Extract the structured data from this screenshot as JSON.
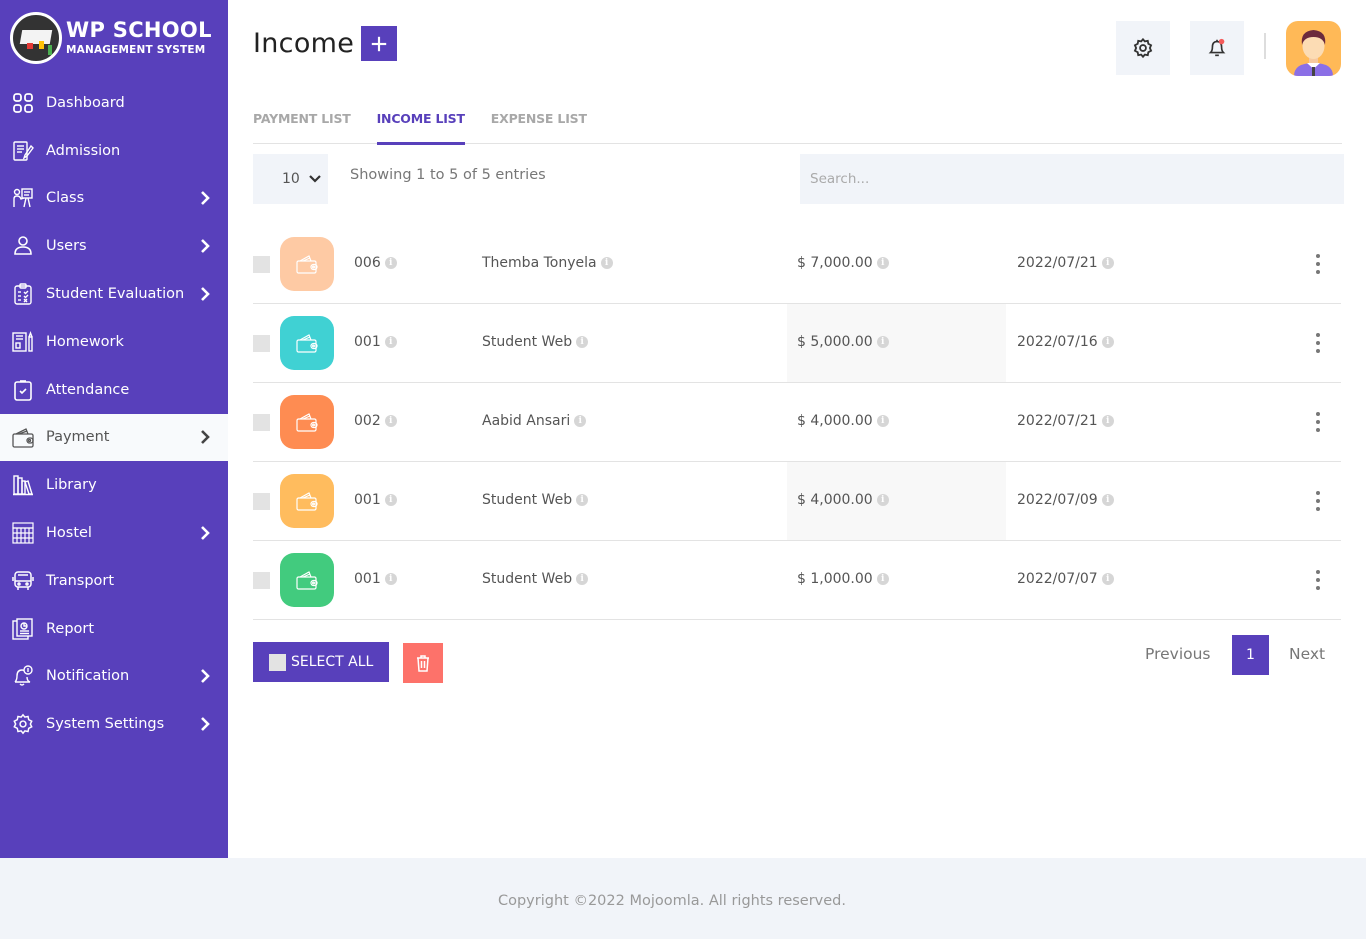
{
  "brand": {
    "title": "WP SCHOOL",
    "subtitle": "MANAGEMENT SYSTEM"
  },
  "sidebar": {
    "items": [
      {
        "label": "Dashboard",
        "icon": "dashboard-grid-icon",
        "has_submenu": false,
        "active": false
      },
      {
        "label": "Admission",
        "icon": "admission-form-icon",
        "has_submenu": false,
        "active": false
      },
      {
        "label": "Class",
        "icon": "class-teacher-board-icon",
        "has_submenu": true,
        "active": false
      },
      {
        "label": "Users",
        "icon": "user-icon",
        "has_submenu": true,
        "active": false
      },
      {
        "label": "Student Evaluation",
        "icon": "evaluation-clipboard-icon",
        "has_submenu": true,
        "active": false
      },
      {
        "label": "Homework",
        "icon": "homework-notebook-icon",
        "has_submenu": false,
        "active": false
      },
      {
        "label": "Attendance",
        "icon": "attendance-check-icon",
        "has_submenu": false,
        "active": false
      },
      {
        "label": "Payment",
        "icon": "wallet-icon",
        "has_submenu": true,
        "active": true
      },
      {
        "label": "Library",
        "icon": "library-books-icon",
        "has_submenu": false,
        "active": false
      },
      {
        "label": "Hostel",
        "icon": "hostel-building-icon",
        "has_submenu": true,
        "active": false
      },
      {
        "label": "Transport",
        "icon": "bus-icon",
        "has_submenu": false,
        "active": false
      },
      {
        "label": "Report",
        "icon": "report-icon",
        "has_submenu": false,
        "active": false
      },
      {
        "label": "Notification",
        "icon": "notification-bell-icon",
        "has_submenu": true,
        "active": false
      },
      {
        "label": "System Settings",
        "icon": "settings-gear-icon",
        "has_submenu": true,
        "active": false
      }
    ]
  },
  "header": {
    "title": "Income",
    "add_label": "+",
    "settings_icon": "gear-icon",
    "notification_icon": "bell-icon",
    "has_unread_notification": true,
    "avatar": "user-avatar"
  },
  "tabs": [
    {
      "label": "PAYMENT LIST",
      "active": false
    },
    {
      "label": "INCOME LIST",
      "active": true
    },
    {
      "label": "EXPENSE LIST",
      "active": false
    }
  ],
  "table_controls": {
    "page_length": "10",
    "info": "Showing 1 to 5 of 5 entries",
    "search_placeholder": "Search...",
    "search_value": ""
  },
  "rows": [
    {
      "id": "006",
      "name": "Themba Tonyela",
      "amount": "$ 7,000.00",
      "date": "2022/07/21",
      "color": "#fecaa4"
    },
    {
      "id": "001",
      "name": "Student Web",
      "amount": "$ 5,000.00",
      "date": "2022/07/16",
      "color": "#40d1d3"
    },
    {
      "id": "002",
      "name": "Aabid Ansari",
      "amount": "$ 4,000.00",
      "date": "2022/07/21",
      "color": "#fe8c52"
    },
    {
      "id": "001",
      "name": "Student Web",
      "amount": "$ 4,000.00",
      "date": "2022/07/09",
      "color": "#ffbc5e"
    },
    {
      "id": "001",
      "name": "Student Web",
      "amount": "$ 1,000.00",
      "date": "2022/07/07",
      "color": "#42cb7e"
    }
  ],
  "actions": {
    "select_all_label": "SELECT ALL",
    "delete_icon": "trash-icon"
  },
  "pagination": {
    "previous_label": "Previous",
    "current_page": "1",
    "next_label": "Next"
  },
  "footer": {
    "copyright": "Copyright ©2022 Mojoomla. All rights reserved."
  },
  "colors": {
    "primary": "#5840bb",
    "danger": "#fd726a",
    "muted_bg": "#f1f4f9"
  }
}
